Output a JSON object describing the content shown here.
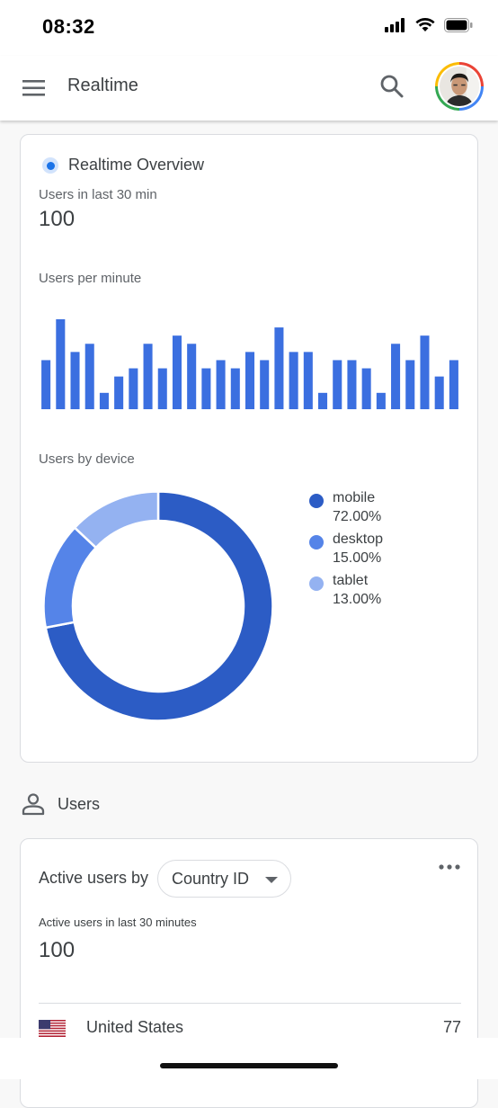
{
  "status_bar": {
    "time": "08:32"
  },
  "app_bar": {
    "title": "Realtime"
  },
  "overview": {
    "title": "Realtime Overview",
    "users_label": "Users in last 30 min",
    "users_value": "100",
    "per_minute_label": "Users per minute",
    "device_label": "Users by device"
  },
  "chart_data": [
    {
      "type": "bar",
      "title": "Users per minute",
      "values": [
        6,
        11,
        7,
        8,
        2,
        4,
        5,
        8,
        5,
        9,
        8,
        5,
        6,
        5,
        7,
        6,
        10,
        7,
        7,
        2,
        6,
        6,
        5,
        2,
        8,
        6,
        9,
        4,
        6
      ],
      "color": "#3b6fe0"
    },
    {
      "type": "pie",
      "title": "Users by device",
      "series": [
        {
          "name": "mobile",
          "value": 72.0,
          "label": "72.00%",
          "color": "#2c5cc5"
        },
        {
          "name": "desktop",
          "value": 15.0,
          "label": "15.00%",
          "color": "#5584e8"
        },
        {
          "name": "tablet",
          "value": 13.0,
          "label": "13.00%",
          "color": "#94b2f1"
        }
      ]
    }
  ],
  "users_section": {
    "title": "Users"
  },
  "active_users": {
    "label": "Active users by",
    "dimension": "Country ID",
    "sub_label": "Active users in last 30 minutes",
    "value": "100",
    "rows": [
      {
        "country": "United States",
        "count": "77"
      }
    ]
  }
}
